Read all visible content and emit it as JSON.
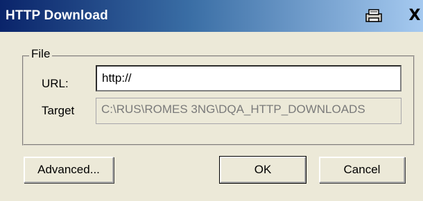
{
  "window": {
    "title": "HTTP Download",
    "printer_icon": "printer-icon",
    "close_icon": "close-icon",
    "close_glyph": "X"
  },
  "group": {
    "label": "File"
  },
  "fields": {
    "url_label": "URL:",
    "url_value": "http://",
    "target_label": "Target",
    "target_value": "C:\\RUS\\ROMES 3NG\\DQA_HTTP_DOWNLOADS"
  },
  "buttons": {
    "advanced": "Advanced...",
    "ok": "OK",
    "cancel": "Cancel"
  },
  "colors": {
    "titlebar_start": "#0a246a",
    "titlebar_end": "#a6caf0",
    "dialog_bg": "#ece9d8"
  }
}
